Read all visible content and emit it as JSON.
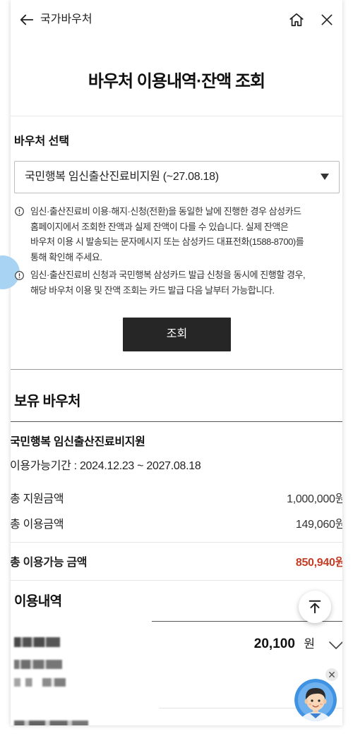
{
  "header": {
    "title": "국가바우처"
  },
  "page_title": "바우처 이용내역·잔액 조회",
  "voucher_select": {
    "label": "바우처 선택",
    "selected": "국민행복 임신출산진료비지원 (~27.08.18)"
  },
  "notices": [
    {
      "lines": [
        "임신·출산진료비 이용·해지·신청(전환)을 동일한 날에 진행한 경우 삼성카드",
        "홈페이지에서 조회한 잔액과 실제 잔액이 다를 수 있습니다. 실제 잔액은",
        "바우처 이용 시 발송되는 문자메시지 또는 삼성카드 대표전화(1588-8700)를",
        "통해 확인해 주세요."
      ]
    },
    {
      "lines": [
        "임신·출산진료비 신청과 국민행복 삼성카드 발급 신청을 동시에 진행할 경우,",
        "해당 바우처 이용 및 잔액 조회는 카드 발급 다음 날부터 가능합니다."
      ]
    }
  ],
  "inquiry_button": "조회",
  "owned_vouchers": {
    "title": "보유 바우처",
    "name": "국민행복 임신출산진료비지원",
    "period": "이용가능기간 : 2024.12.23 ~ 2027.08.18",
    "rows": [
      {
        "label": "총 지원금액",
        "value": "1,000,000원"
      },
      {
        "label": "총 이용금액",
        "value": "149,060원"
      }
    ],
    "available": {
      "label": "총 이용가능 금액",
      "value": "850,940원"
    }
  },
  "history": {
    "title": "이용내역",
    "items": [
      {
        "amount": "20,100",
        "unit": "원"
      }
    ]
  },
  "icons": {
    "back": "arrow-left-icon",
    "home": "home-icon",
    "close": "close-icon",
    "select_caret": "caret-down-icon",
    "notice": "notice-icon",
    "expand": "chevron-down-icon",
    "scroll_top": "scroll-top-icon",
    "chatbot": "chatbot-avatar-icon"
  },
  "colors": {
    "accent_red": "#c43d25",
    "button_bg": "#262626",
    "chatbot_bg": "#3f93e2",
    "floating_circle": "#a9d3f2"
  }
}
